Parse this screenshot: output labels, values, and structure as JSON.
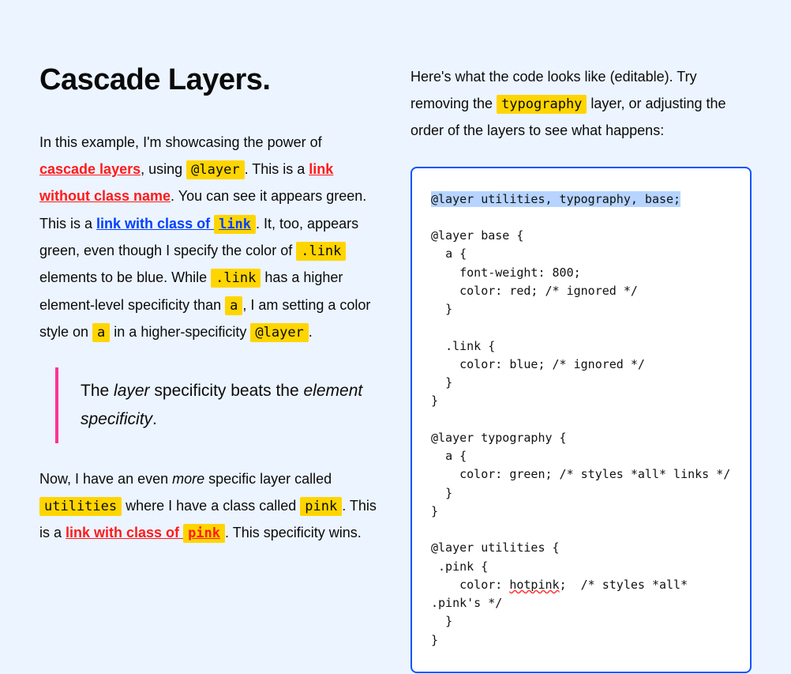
{
  "heading": "Cascade Layers.",
  "para1": {
    "t1": "In this example, I'm showcasing the power of ",
    "link_cascade": "cascade layers",
    "t2": ", using ",
    "code_layer": "@layer",
    "t3": ". This is a ",
    "link_noclass": "link without class name",
    "t4": ". You can see it appears green. This is a ",
    "link_withclass_pre": "link with class of ",
    "link_withclass_code": "link",
    "t5": ". It, too, appears green, even though I specify the color of ",
    "code_dotlink1": ".link",
    "t6": " elements to be blue. While ",
    "code_dotlink2": ".link",
    "t7": " has a higher element-level specificity than ",
    "code_a1": "a",
    "t8": ", I am setting a color style on ",
    "code_a2": "a",
    "t9": " in a higher-specificity ",
    "code_layer2": "@layer",
    "t10": "."
  },
  "quote": {
    "t1": "The ",
    "em1": "layer",
    "t2": " specificity beats the ",
    "em2": "element specificity",
    "t3": "."
  },
  "para2": {
    "t1": "Now, I have an even ",
    "em_more": "more",
    "t2": " specific layer called ",
    "code_util": "utilities",
    "t3": " where I have a class called ",
    "code_pink": "pink",
    "t4": ". This is a ",
    "link_pink_pre": "link with class of ",
    "link_pink_code": "pink",
    "t5": ". This specificity wins."
  },
  "right_intro": {
    "t1": "Here's what the code looks like (editable). Try removing the ",
    "code_typo": "typography",
    "t2": " layer, or adjusting the order of the layers to see what happens:"
  },
  "code": {
    "sel_line": "@layer utilities, typography, base;",
    "l1": "@layer base {",
    "l2": "  a {",
    "l3": "    font-weight: 800;",
    "l4": "    color: red; /* ignored */",
    "l5": "  }",
    "l6": "  .link {",
    "l7": "    color: blue; /* ignored */",
    "l8": "  }",
    "l9": "}",
    "l10": "@layer typography {",
    "l11": "  a {",
    "l12": "    color: green; /* styles *all* links */",
    "l13": "  }",
    "l14": "}",
    "l15": "@layer utilities {",
    "l16": " .pink {",
    "l17a": "    color: ",
    "l17b": "hotpink",
    "l17c": ";  /* styles *all* .pink's */",
    "l18": "  }",
    "l19": "}"
  }
}
